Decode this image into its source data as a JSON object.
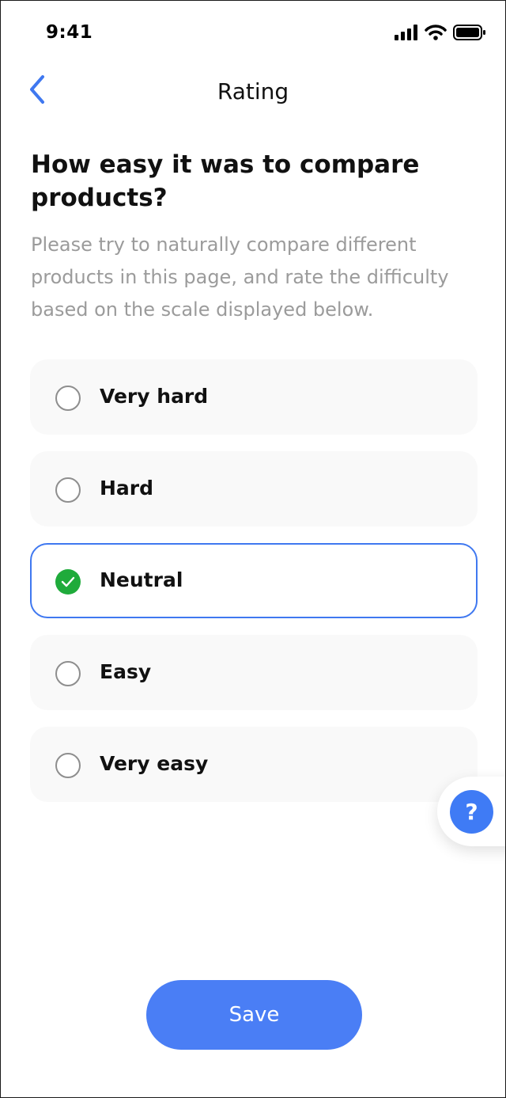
{
  "status_bar": {
    "time": "9:41",
    "icons": [
      "signal-icon",
      "wifi-icon",
      "battery-icon"
    ]
  },
  "header": {
    "back_icon": "chevron-left-icon",
    "title": "Rating"
  },
  "question": {
    "title": "How easy it was to compare products?",
    "description": "Please try to naturally compare different products in this page, and rate the difficulty based on the scale displayed below."
  },
  "options": [
    {
      "label": "Very hard",
      "selected": false
    },
    {
      "label": "Hard",
      "selected": false
    },
    {
      "label": "Neutral",
      "selected": true
    },
    {
      "label": "Easy",
      "selected": false
    },
    {
      "label": "Very easy",
      "selected": false
    }
  ],
  "help": {
    "label": "?"
  },
  "save": {
    "label": "Save"
  },
  "colors": {
    "accent": "#4a7ef5",
    "selected_border": "#3f78f0",
    "check": "#1fab3b",
    "muted_text": "#9b9b9b",
    "option_bg": "#f9f9f9"
  }
}
